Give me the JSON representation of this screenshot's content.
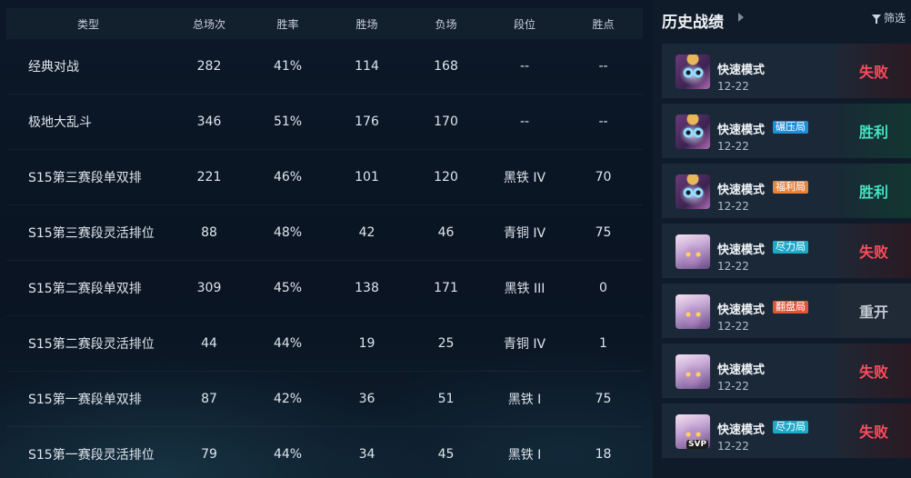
{
  "stats": {
    "headers": [
      "类型",
      "总场次",
      "胜率",
      "胜场",
      "负场",
      "段位",
      "胜点"
    ],
    "rows": [
      [
        "经典对战",
        "282",
        "41%",
        "114",
        "168",
        "--",
        "--"
      ],
      [
        "极地大乱斗",
        "346",
        "51%",
        "176",
        "170",
        "--",
        "--"
      ],
      [
        "S15第三赛段单双排",
        "221",
        "46%",
        "101",
        "120",
        "黑铁 IV",
        "70"
      ],
      [
        "S15第三赛段灵活排位",
        "88",
        "48%",
        "42",
        "46",
        "青铜 IV",
        "75"
      ],
      [
        "S15第二赛段单双排",
        "309",
        "45%",
        "138",
        "171",
        "黑铁 III",
        "0"
      ],
      [
        "S15第二赛段灵活排位",
        "44",
        "44%",
        "19",
        "25",
        "青铜 IV",
        "1"
      ],
      [
        "S15第一赛段单双排",
        "87",
        "42%",
        "36",
        "51",
        "黑铁 I",
        "75"
      ],
      [
        "S15第一赛段灵活排位",
        "79",
        "44%",
        "34",
        "45",
        "黑铁 I",
        "18"
      ]
    ]
  },
  "history": {
    "title": "历史战绩",
    "filter_label": "筛选",
    "matches": [
      {
        "mode": "快速模式",
        "tag": "",
        "tag_color": "",
        "date": "12-22",
        "result": "失败",
        "result_type": "loss",
        "champion_icon": "yuumi-avatar",
        "badge": ""
      },
      {
        "mode": "快速模式",
        "tag": "碾压局",
        "tag_color": "#1e8ed6",
        "date": "12-22",
        "result": "胜利",
        "result_type": "win",
        "champion_icon": "yuumi-avatar",
        "badge": ""
      },
      {
        "mode": "快速模式",
        "tag": "福利局",
        "tag_color": "#e8833a",
        "date": "12-22",
        "result": "胜利",
        "result_type": "win",
        "champion_icon": "yuumi-avatar",
        "badge": ""
      },
      {
        "mode": "快速模式",
        "tag": "尽力局",
        "tag_color": "#1fa9c9",
        "date": "12-22",
        "result": "失败",
        "result_type": "loss",
        "champion_icon": "soraka-avatar",
        "badge": ""
      },
      {
        "mode": "快速模式",
        "tag": "翻盘局",
        "tag_color": "#e0553a",
        "date": "12-22",
        "result": "重开",
        "result_type": "remake",
        "champion_icon": "soraka-avatar",
        "badge": ""
      },
      {
        "mode": "快速模式",
        "tag": "",
        "tag_color": "",
        "date": "12-22",
        "result": "失败",
        "result_type": "loss",
        "champion_icon": "soraka-avatar",
        "badge": ""
      },
      {
        "mode": "快速模式",
        "tag": "尽力局",
        "tag_color": "#1fa9c9",
        "date": "12-22",
        "result": "失败",
        "result_type": "loss",
        "champion_icon": "soraka-avatar",
        "badge": "SVP"
      }
    ]
  }
}
